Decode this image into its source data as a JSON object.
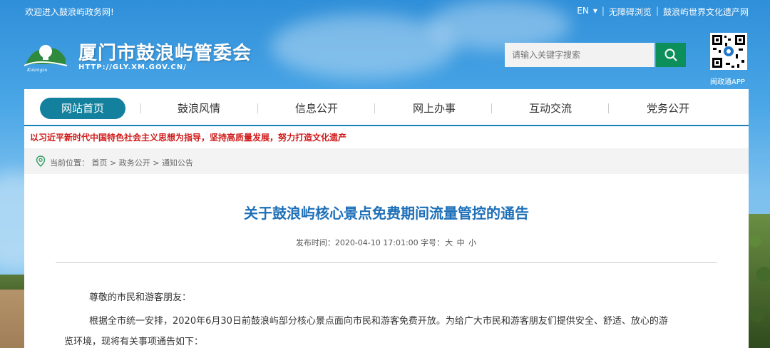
{
  "top_bar": {
    "welcome": "欢迎进入鼓浪屿政务网!",
    "links": [
      "EN",
      "无障碍浏览",
      "鼓浪屿世界文化遗产网"
    ]
  },
  "header": {
    "title": "厦门市鼓浪屿管委会",
    "url": "HTTP://GLY.XM.GOV.CN/",
    "search_placeholder": "请输入关键字搜索",
    "qr_label": "闽政通APP"
  },
  "nav": {
    "items": [
      "网站首页",
      "鼓浪风情",
      "信息公开",
      "网上办事",
      "互动交流",
      "党务公开"
    ]
  },
  "slogan": "以习近平新时代中国特色社会主义思想为指导，坚持高质量发展，努力打造文化遗产",
  "breadcrumb": {
    "prefix": "当前位置：",
    "items": [
      "首页",
      "政务公开",
      "通知公告"
    ],
    "separator": ">"
  },
  "article": {
    "title": "关于鼓浪屿核心景点免费期间流量管控的通告",
    "publish_label": "发布时间：",
    "publish_time": "2020-04-10 17:01:00",
    "font_label": "字号：",
    "font_sizes": [
      "大",
      "中",
      "小"
    ],
    "greeting": "尊敬的市民和游客朋友：",
    "body_line1": "根据全市统一安排，2020年6月30日前鼓浪屿部分核心景点面向市民和游客免费开放。为给广大市民和游客朋友们提供安全、舒适、放心的游",
    "body_line2": "览环境，现将有关事项通告如下："
  },
  "colors": {
    "nav_active": "#13819e",
    "title_blue": "#1d6fb8",
    "slogan_red": "#d01919",
    "search_green": "#0c8f5a"
  }
}
